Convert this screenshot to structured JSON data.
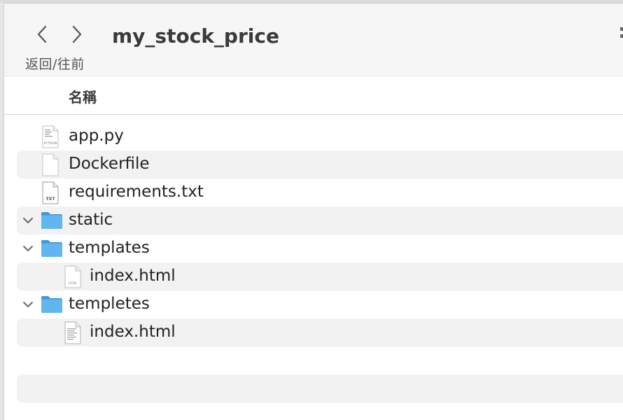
{
  "toolbar": {
    "back_icon": "chevron-left-icon",
    "forward_icon": "chevron-right-icon",
    "nav_label": "返回/往前",
    "title": "my_stock_price"
  },
  "columns": {
    "name": "名稱"
  },
  "files": [
    {
      "name": "app.py",
      "icon": "python-file-icon",
      "badge": "PYTHON"
    },
    {
      "name": "Dockerfile",
      "icon": "blank-file-icon"
    },
    {
      "name": "requirements.txt",
      "icon": "text-file-icon",
      "badge": "TXT"
    },
    {
      "name": "static",
      "icon": "folder-icon",
      "expanded": true
    },
    {
      "name": "templates",
      "icon": "folder-icon",
      "expanded": true
    },
    {
      "name": "index.html",
      "icon": "html-file-icon",
      "badge": "HTML"
    },
    {
      "name": "templetes",
      "icon": "folder-icon",
      "expanded": true
    },
    {
      "name": "index.html",
      "icon": "html-file-icon"
    }
  ],
  "colors": {
    "folder_blue": "#62b6ef",
    "folder_tab": "#3f97d6",
    "row_alt": "#f2f2f2",
    "toolbar_bg": "#f6f6f6"
  }
}
